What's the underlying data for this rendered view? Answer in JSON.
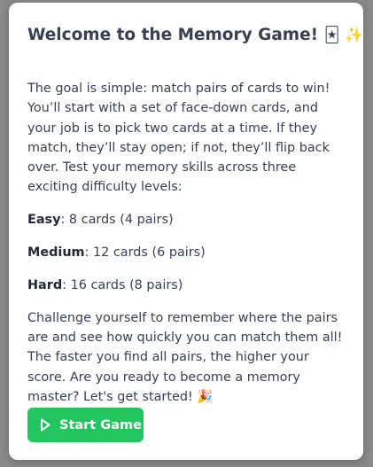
{
  "modal": {
    "title": "Welcome to the Memory Game!",
    "title_emoji": "🃏 ✨",
    "intro": "The goal is simple: match pairs of cards to win! You’ll start with a set of face-down cards, and your job is to pick two cards at a time. If they match, they’ll stay open; if not, they’ll flip back over. Test your memory skills across three exciting difficulty levels:",
    "levels": [
      {
        "name": "Easy",
        "desc": ": 8 cards (4 pairs)"
      },
      {
        "name": "Medium",
        "desc": ": 12 cards (6 pairs)"
      },
      {
        "name": "Hard",
        "desc": ": 16 cards (8 pairs)"
      }
    ],
    "outro": "Challenge yourself to remember where the pairs are and see how quickly you can match them all! The faster you find all pairs, the higher your score. Are you ready to become a memory master? Let's get started! 🎉",
    "start_button": "Start Game",
    "start_icon": "play-icon"
  },
  "colors": {
    "accent": "#22c55e",
    "text": "#374151",
    "backdrop": "#8a8a8a"
  }
}
